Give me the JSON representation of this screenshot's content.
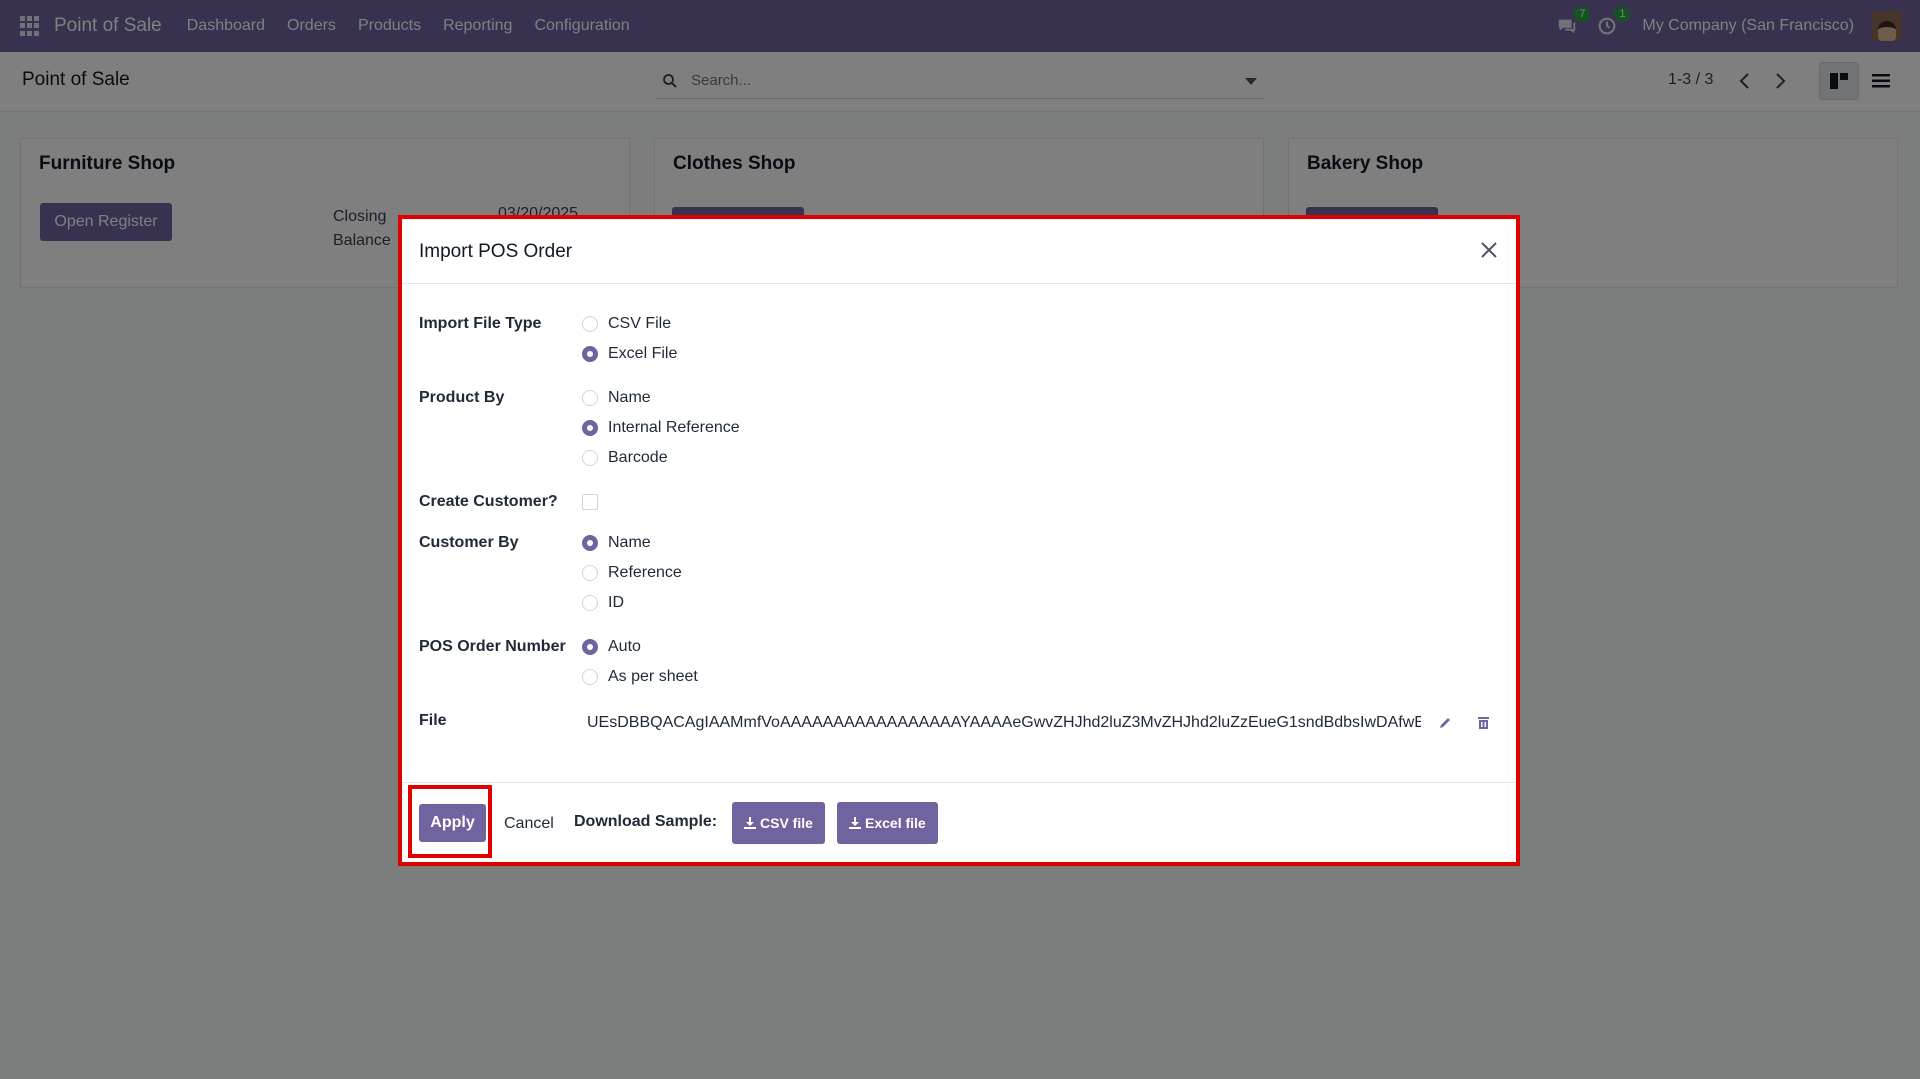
{
  "navbar": {
    "app_name": "Point of Sale",
    "menu": [
      "Dashboard",
      "Orders",
      "Products",
      "Reporting",
      "Configuration"
    ],
    "messages_count": "7",
    "activities_count": "1",
    "company": "My Company (San Francisco)"
  },
  "control_panel": {
    "title": "Point of Sale",
    "search_placeholder": "Search...",
    "pager": "1-3 / 3"
  },
  "cards": [
    {
      "title": "Furniture Shop",
      "button": "Open Register",
      "closing_label": "Closing Balance",
      "date": "03/20/2025"
    },
    {
      "title": "Clothes Shop"
    },
    {
      "title": "Bakery Shop"
    }
  ],
  "dialog": {
    "title": "Import POS Order",
    "fields": {
      "import_file_type": {
        "label": "Import File Type",
        "options": [
          "CSV File",
          "Excel File"
        ],
        "selected": "Excel File"
      },
      "product_by": {
        "label": "Product By",
        "options": [
          "Name",
          "Internal Reference",
          "Barcode"
        ],
        "selected": "Internal Reference"
      },
      "create_customer": {
        "label": "Create Customer?",
        "checked": false
      },
      "customer_by": {
        "label": "Customer By",
        "options": [
          "Name",
          "Reference",
          "ID"
        ],
        "selected": "Name"
      },
      "pos_order_number": {
        "label": "POS Order Number",
        "options": [
          "Auto",
          "As per sheet"
        ],
        "selected": "Auto"
      },
      "file": {
        "label": "File",
        "value": "UEsDBBQACAgIAAMmfVoAAAAAAAAAAAAAAAAAYAAAAeGwvZHJhd2luZ3MvZHJhd2luZzEueG1sndBdbsIwDAfwE"
      }
    },
    "footer": {
      "apply": "Apply",
      "cancel": "Cancel",
      "download_label": "Download Sample:",
      "csv_button": "CSV file",
      "excel_button": "Excel file"
    }
  },
  "colors": {
    "brand": "#71639e",
    "highlight": "#e00000"
  }
}
